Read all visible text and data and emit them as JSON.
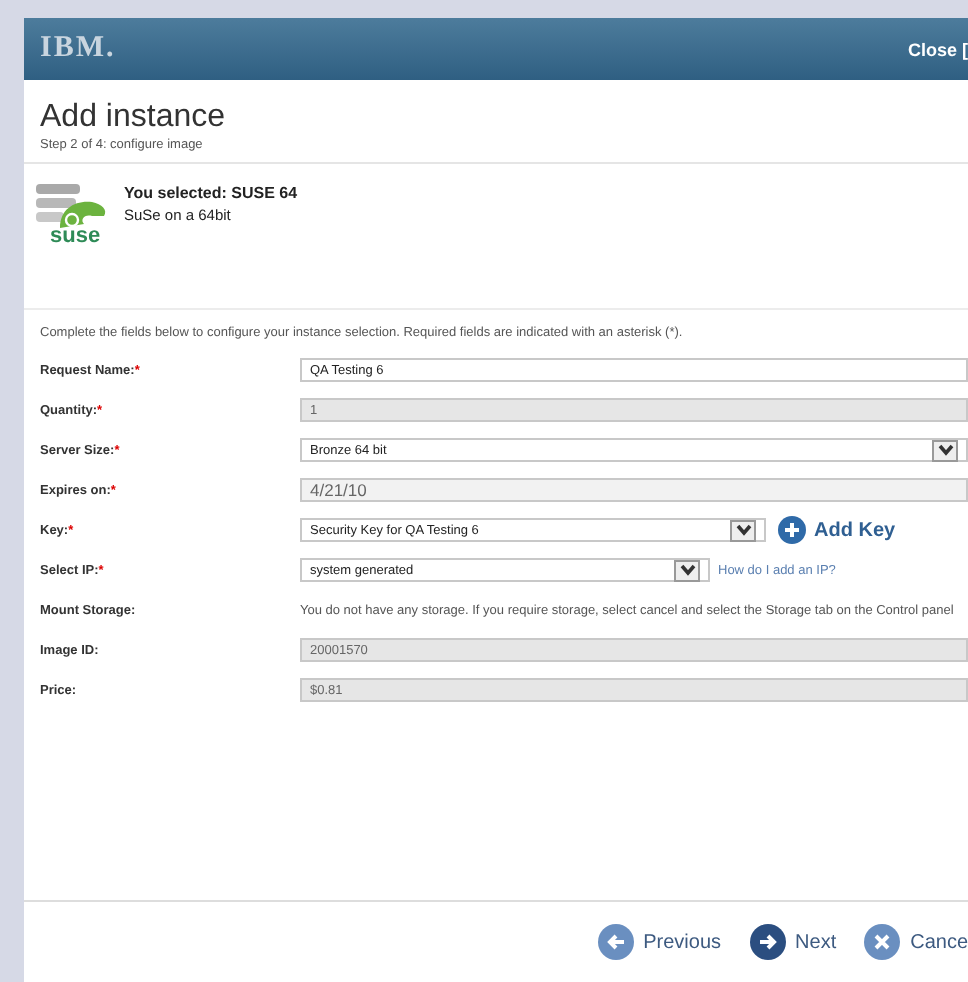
{
  "header": {
    "brand": "IBM.",
    "close_label": "Close ["
  },
  "title": "Add instance",
  "subtitle": "Step 2 of 4: configure image",
  "selection": {
    "logo_text": "suse",
    "heading": "You selected: SUSE 64",
    "description": "SuSe on a 64bit"
  },
  "instructions": "Complete the fields below to configure your instance selection. Required fields are indicated with an asterisk (*).",
  "fields": [
    {
      "label": "Request Name:",
      "required_mark": "*",
      "kind": "text",
      "value": "QA Testing 6"
    },
    {
      "label": "Quantity:",
      "required_mark": "*",
      "kind": "readonly",
      "value": "1"
    },
    {
      "label": "Server Size:",
      "required_mark": "*",
      "kind": "select",
      "value": "Bronze 64 bit"
    },
    {
      "label": "Expires on:",
      "required_mark": "*",
      "kind": "date",
      "value": "4/21/10"
    },
    {
      "label": "Key:",
      "required_mark": "*",
      "kind": "select_add",
      "value": "Security Key for QA Testing 6",
      "action": "Add Key"
    },
    {
      "label": "Select IP:",
      "required_mark": "*",
      "kind": "select_link",
      "value": "system generated",
      "link": "How do I add an IP?"
    },
    {
      "label": "Mount Storage:",
      "kind": "note",
      "value": "You do not have any storage. If you require storage, select cancel and select the Storage tab on the Control panel"
    },
    {
      "label": "Image ID:",
      "kind": "readonly",
      "value": "20001570"
    },
    {
      "label": "Price:",
      "kind": "readonly",
      "value": "$0.81"
    }
  ],
  "buttons": [
    {
      "label": "Previous",
      "kind": "previous"
    },
    {
      "label": "Next",
      "kind": "next"
    },
    {
      "label": "Cance",
      "kind": "cancel"
    }
  ]
}
